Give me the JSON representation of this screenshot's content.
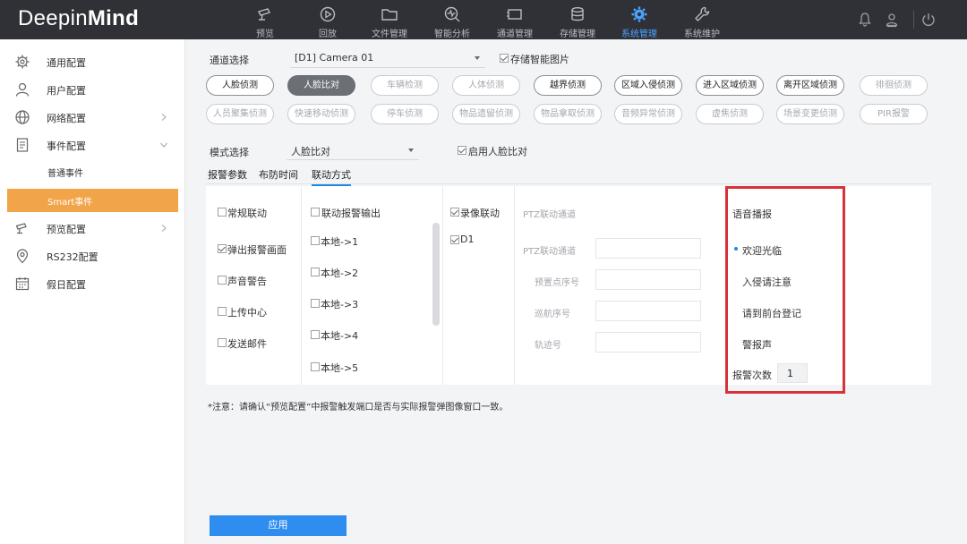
{
  "brand": {
    "part1": "Deepin",
    "part2": "Mind"
  },
  "top_nav": [
    {
      "label": "预览",
      "icon": "camera-icon"
    },
    {
      "label": "回放",
      "icon": "playback-icon"
    },
    {
      "label": "文件管理",
      "icon": "folder-icon"
    },
    {
      "label": "智能分析",
      "icon": "analytics-icon"
    },
    {
      "label": "通道管理",
      "icon": "channel-icon"
    },
    {
      "label": "存储管理",
      "icon": "database-icon"
    },
    {
      "label": "系统管理",
      "icon": "gear-icon",
      "active": true
    },
    {
      "label": "系统维护",
      "icon": "wrench-icon"
    }
  ],
  "top_right_icons": [
    "bell-icon",
    "user-lock-icon",
    "power-icon"
  ],
  "sidebar": {
    "items": [
      {
        "label": "通用配置",
        "icon": "gear-outline-icon"
      },
      {
        "label": "用户配置",
        "icon": "user-icon"
      },
      {
        "label": "网络配置",
        "icon": "globe-icon"
      },
      {
        "label": "事件配置",
        "icon": "document-icon"
      },
      {
        "label": "预览配置",
        "icon": "camera-outline-icon"
      },
      {
        "label": "RS232配置",
        "icon": "location-icon"
      },
      {
        "label": "假日配置",
        "icon": "calendar-icon"
      }
    ],
    "subitems": [
      {
        "label": "普通事件"
      },
      {
        "label": "Smart事件",
        "active": true
      }
    ]
  },
  "channel": {
    "label": "通道选择",
    "value": "[D1] Camera 01",
    "store_image_label": "存储智能图片",
    "store_image_checked": true
  },
  "event_buttons_row1": [
    {
      "label": "人脸侦测",
      "state": "normal"
    },
    {
      "label": "人脸比对",
      "state": "selected"
    },
    {
      "label": "车辆检测",
      "state": "dim"
    },
    {
      "label": "人体侦测",
      "state": "dim"
    },
    {
      "label": "越界侦测",
      "state": "normal"
    },
    {
      "label": "区域入侵侦测",
      "state": "normal"
    },
    {
      "label": "进入区域侦测",
      "state": "normal"
    },
    {
      "label": "离开区域侦测",
      "state": "normal"
    },
    {
      "label": "徘徊侦测",
      "state": "dim"
    }
  ],
  "event_buttons_row2": [
    {
      "label": "人员聚集侦测",
      "state": "dim"
    },
    {
      "label": "快速移动侦测",
      "state": "dim"
    },
    {
      "label": "停车侦测",
      "state": "dim"
    },
    {
      "label": "物品遗留侦测",
      "state": "dim"
    },
    {
      "label": "物品拿取侦测",
      "state": "dim"
    },
    {
      "label": "音频异常侦测",
      "state": "dim"
    },
    {
      "label": "虚焦侦测",
      "state": "dim"
    },
    {
      "label": "场景变更侦测",
      "state": "dim"
    },
    {
      "label": "PIR报警",
      "state": "dim"
    }
  ],
  "mode": {
    "label": "模式选择",
    "value": "人脸比对",
    "enable_label": "启用人脸比对",
    "enable_checked": true
  },
  "tabs": [
    {
      "label": "报警参数"
    },
    {
      "label": "布防时间"
    },
    {
      "label": "联动方式",
      "active": true
    }
  ],
  "linkage": {
    "col1": [
      {
        "label": "常规联动",
        "checked": false
      },
      {
        "label": "弹出报警画面",
        "checked": true
      },
      {
        "label": "声音警告",
        "checked": false
      },
      {
        "label": "上传中心",
        "checked": false
      },
      {
        "label": "发送邮件",
        "checked": false
      }
    ],
    "col2_header": {
      "label": "联动报警输出",
      "checked": false
    },
    "col2": [
      {
        "label": "本地->1",
        "checked": false
      },
      {
        "label": "本地->2",
        "checked": false
      },
      {
        "label": "本地->3",
        "checked": false
      },
      {
        "label": "本地->4",
        "checked": false
      },
      {
        "label": "本地->5",
        "checked": false
      }
    ],
    "col3_header": {
      "label": "录像联动",
      "checked": true
    },
    "col3": [
      {
        "label": "D1",
        "checked": true
      }
    ],
    "ptz": {
      "header": "PTZ联动通道",
      "fields": [
        {
          "label": "PTZ联动通道"
        },
        {
          "label": "预置点序号"
        },
        {
          "label": "巡航序号"
        },
        {
          "label": "轨迹号"
        }
      ]
    },
    "voice": {
      "header": "语音播报",
      "options": [
        {
          "label": "欢迎光临",
          "selected": true
        },
        {
          "label": "入侵请注意"
        },
        {
          "label": "请到前台登记"
        },
        {
          "label": "警报声"
        }
      ],
      "count_label": "报警次数",
      "count_value": "1"
    }
  },
  "note": "*注意：请确认“预览配置”中报警触发端口是否与实际报警弹图像窗口一致。",
  "apply_label": "应用",
  "colors": {
    "accent": "#2f8df0",
    "sidebar_active": "#f2a448",
    "highlight_border": "#d9303a",
    "topbar": "#2f3136"
  }
}
